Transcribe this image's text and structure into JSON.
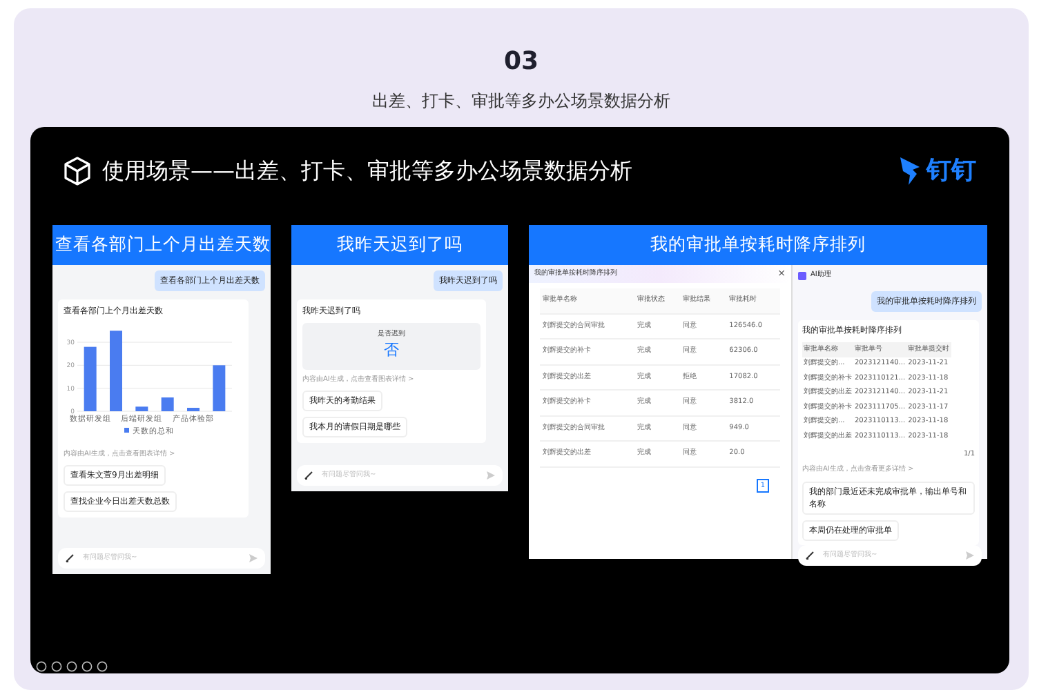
{
  "section_number": "03",
  "subtitle": "出差、打卡、审批等多办公场景数据分析",
  "banner": {
    "title": "使用场景——出差、打卡、审批等多办公场景数据分析",
    "logo_text": "钉钉"
  },
  "panels": [
    {
      "kind": "chart",
      "heading": "查看各部门上个月出差天数",
      "user_message": "查看各部门上个月出差天数",
      "card_title": "查看各部门上个月出差天数",
      "chart_data": {
        "type": "bar",
        "categories": [
          "数据研发组",
          null,
          "后端研发组",
          null,
          "产品体验部",
          null
        ],
        "yticks": [
          0,
          10,
          20,
          30
        ],
        "ylim": [
          0,
          36
        ],
        "grid": true,
        "series": [
          {
            "name": "天数的总和",
            "color": "#4a7cf0",
            "values": [
              28,
              35,
              2,
              6,
              1.5,
              20
            ]
          }
        ]
      },
      "ai_note": "内容由AI生成，点击查看图表详情 >",
      "suggestions": [
        "查看朱文萱9月出差明细",
        "查找企业今日出差天数总数"
      ],
      "input_placeholder": "有问题尽管问我~"
    },
    {
      "kind": "answer",
      "heading": "我昨天迟到了吗",
      "user_message": "我昨天迟到了吗",
      "card_title": "我昨天迟到了吗",
      "answer_label": "是否迟到",
      "answer_value": "否",
      "ai_note": "内容由AI生成，点击查看图表详情 >",
      "suggestions": [
        "我昨天的考勤结果",
        "我本月的请假日期是哪些"
      ],
      "input_placeholder": "有问题尽管问我~"
    },
    {
      "kind": "table",
      "heading": "我的审批单按耗时降序排列",
      "dialog": {
        "title": "我的审批单按耗时降序排列",
        "close": "×",
        "columns": [
          "审批单名称",
          "审批状态",
          "审批结果",
          "审批耗时"
        ],
        "rows": [
          [
            "刘辉提交的合同审批",
            "完成",
            "同意",
            "126546.0"
          ],
          [
            "刘辉提交的补卡",
            "完成",
            "同意",
            "62306.0"
          ],
          [
            "刘辉提交的出差",
            "完成",
            "拒绝",
            "17082.0"
          ],
          [
            "刘辉提交的补卡",
            "完成",
            "同意",
            "3812.0"
          ],
          [
            "刘辉提交的合同审批",
            "完成",
            "同意",
            "949.0"
          ],
          [
            "刘辉提交的出差",
            "完成",
            "同意",
            "20.0"
          ]
        ],
        "pages": [
          {
            "label": "1",
            "selected": true
          }
        ]
      },
      "assistant": {
        "title": "AI助理",
        "user_message": "我的审批单按耗时降序排列",
        "card_title": "我的审批单按耗时降序排列",
        "columns": [
          "审批单名称",
          "审批单号",
          "审批单提交时"
        ],
        "rows": [
          [
            "刘辉提交的...",
            "2023121140...",
            "2023-11-21"
          ],
          [
            "刘辉提交的补卡",
            "2023110121...",
            "2023-11-18"
          ],
          [
            "刘辉提交的出差",
            "2023121140...",
            "2023-11-21"
          ],
          [
            "刘辉提交的补卡",
            "2023111705...",
            "2023-11-17"
          ],
          [
            "刘辉提交的...",
            "2023110113...",
            "2023-11-18"
          ],
          [
            "刘辉提交的出差",
            "2023110113...",
            "2023-11-18"
          ]
        ],
        "pager": "1/1",
        "ai_note": "内容由AI生成，点击查看更多详情 >",
        "suggestions": [
          "我的部门最近还未完成审批单，输出单号和名称",
          "本周仍在处理的审批单"
        ],
        "input_placeholder": "有问题尽管问我~"
      }
    }
  ]
}
